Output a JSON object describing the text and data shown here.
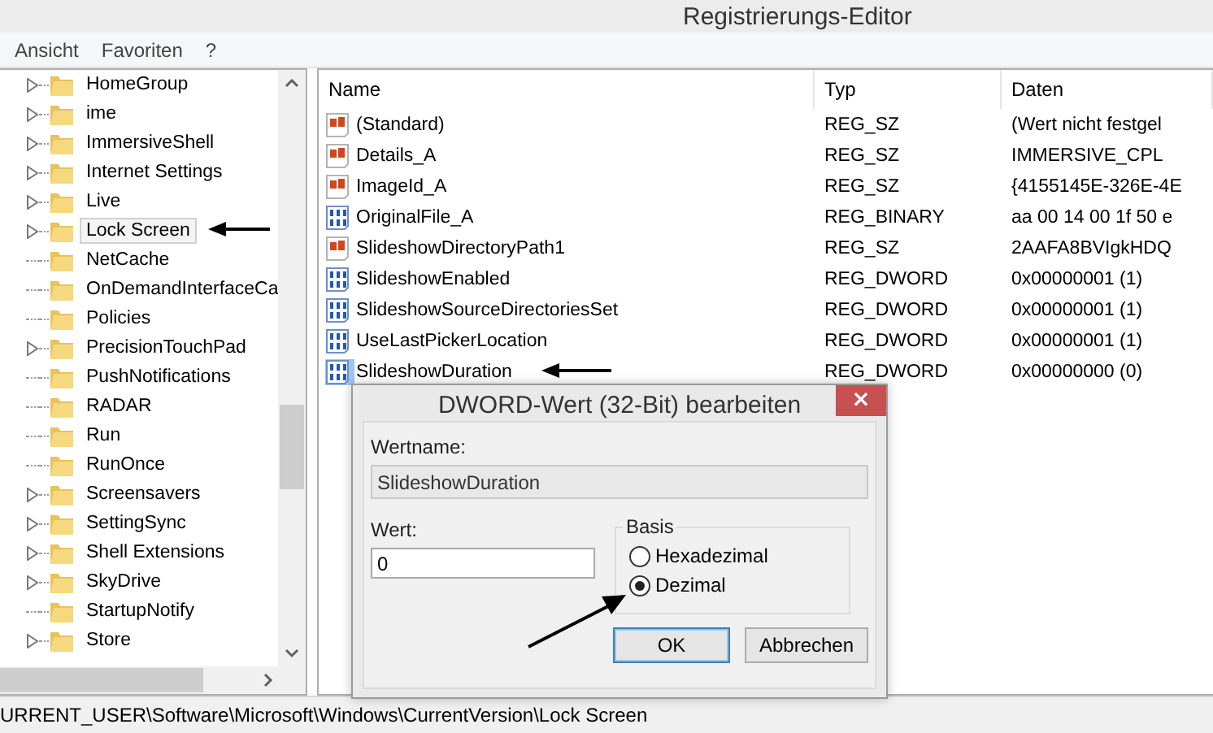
{
  "window": {
    "title": "Registrierungs-Editor"
  },
  "menu": [
    "Ansicht",
    "Favoriten",
    "?"
  ],
  "tree": {
    "items": [
      {
        "label": "HomeGroup",
        "expandable": true,
        "selected": false
      },
      {
        "label": "ime",
        "expandable": true,
        "selected": false
      },
      {
        "label": "ImmersiveShell",
        "expandable": true,
        "selected": false
      },
      {
        "label": "Internet Settings",
        "expandable": true,
        "selected": false
      },
      {
        "label": "Live",
        "expandable": true,
        "selected": false
      },
      {
        "label": "Lock Screen",
        "expandable": true,
        "selected": true
      },
      {
        "label": "NetCache",
        "expandable": false,
        "selected": false
      },
      {
        "label": "OnDemandInterfaceCa",
        "expandable": false,
        "selected": false
      },
      {
        "label": "Policies",
        "expandable": false,
        "selected": false
      },
      {
        "label": "PrecisionTouchPad",
        "expandable": true,
        "selected": false
      },
      {
        "label": "PushNotifications",
        "expandable": false,
        "selected": false
      },
      {
        "label": "RADAR",
        "expandable": false,
        "selected": false
      },
      {
        "label": "Run",
        "expandable": false,
        "selected": false
      },
      {
        "label": "RunOnce",
        "expandable": false,
        "selected": false
      },
      {
        "label": "Screensavers",
        "expandable": true,
        "selected": false
      },
      {
        "label": "SettingSync",
        "expandable": true,
        "selected": false
      },
      {
        "label": "Shell Extensions",
        "expandable": true,
        "selected": false
      },
      {
        "label": "SkyDrive",
        "expandable": true,
        "selected": false
      },
      {
        "label": "StartupNotify",
        "expandable": false,
        "selected": false
      },
      {
        "label": "Store",
        "expandable": true,
        "selected": false
      }
    ]
  },
  "table": {
    "columns": [
      "Name",
      "Typ",
      "Daten"
    ],
    "rows": [
      {
        "kind": "string",
        "name": "(Standard)",
        "type": "REG_SZ",
        "data": "(Wert nicht festgel",
        "selected": false
      },
      {
        "kind": "string",
        "name": "Details_A",
        "type": "REG_SZ",
        "data": "IMMERSIVE_CPL",
        "selected": false
      },
      {
        "kind": "string",
        "name": "ImageId_A",
        "type": "REG_SZ",
        "data": "{4155145E-326E-4E",
        "selected": false
      },
      {
        "kind": "binary",
        "name": "OriginalFile_A",
        "type": "REG_BINARY",
        "data": "aa 00 14 00 1f 50 e",
        "selected": false
      },
      {
        "kind": "string",
        "name": "SlideshowDirectoryPath1",
        "type": "REG_SZ",
        "data": "2AAFA8BVIgkHDQ",
        "selected": false
      },
      {
        "kind": "binary",
        "name": "SlideshowEnabled",
        "type": "REG_DWORD",
        "data": "0x00000001 (1)",
        "selected": false
      },
      {
        "kind": "binary",
        "name": "SlideshowSourceDirectoriesSet",
        "type": "REG_DWORD",
        "data": "0x00000001 (1)",
        "selected": false
      },
      {
        "kind": "binary",
        "name": "UseLastPickerLocation",
        "type": "REG_DWORD",
        "data": "0x00000001 (1)",
        "selected": false
      },
      {
        "kind": "binary",
        "name": "SlideshowDuration",
        "type": "REG_DWORD",
        "data": "0x00000000 (0)",
        "selected": true
      }
    ]
  },
  "status_bar": "URRENT_USER\\Software\\Microsoft\\Windows\\CurrentVersion\\Lock Screen",
  "dialog": {
    "title": "DWORD-Wert (32-Bit) bearbeiten",
    "close": "×",
    "name_label": "Wertname:",
    "name_value": "SlideshowDuration",
    "value_label": "Wert:",
    "value": "0",
    "base_label": "Basis",
    "bases": [
      {
        "label": "Hexadezimal",
        "selected": false
      },
      {
        "label": "Dezimal",
        "selected": true
      }
    ],
    "buttons": [
      {
        "label": "OK",
        "default": true
      },
      {
        "label": "Abbrechen",
        "default": false
      }
    ]
  }
}
